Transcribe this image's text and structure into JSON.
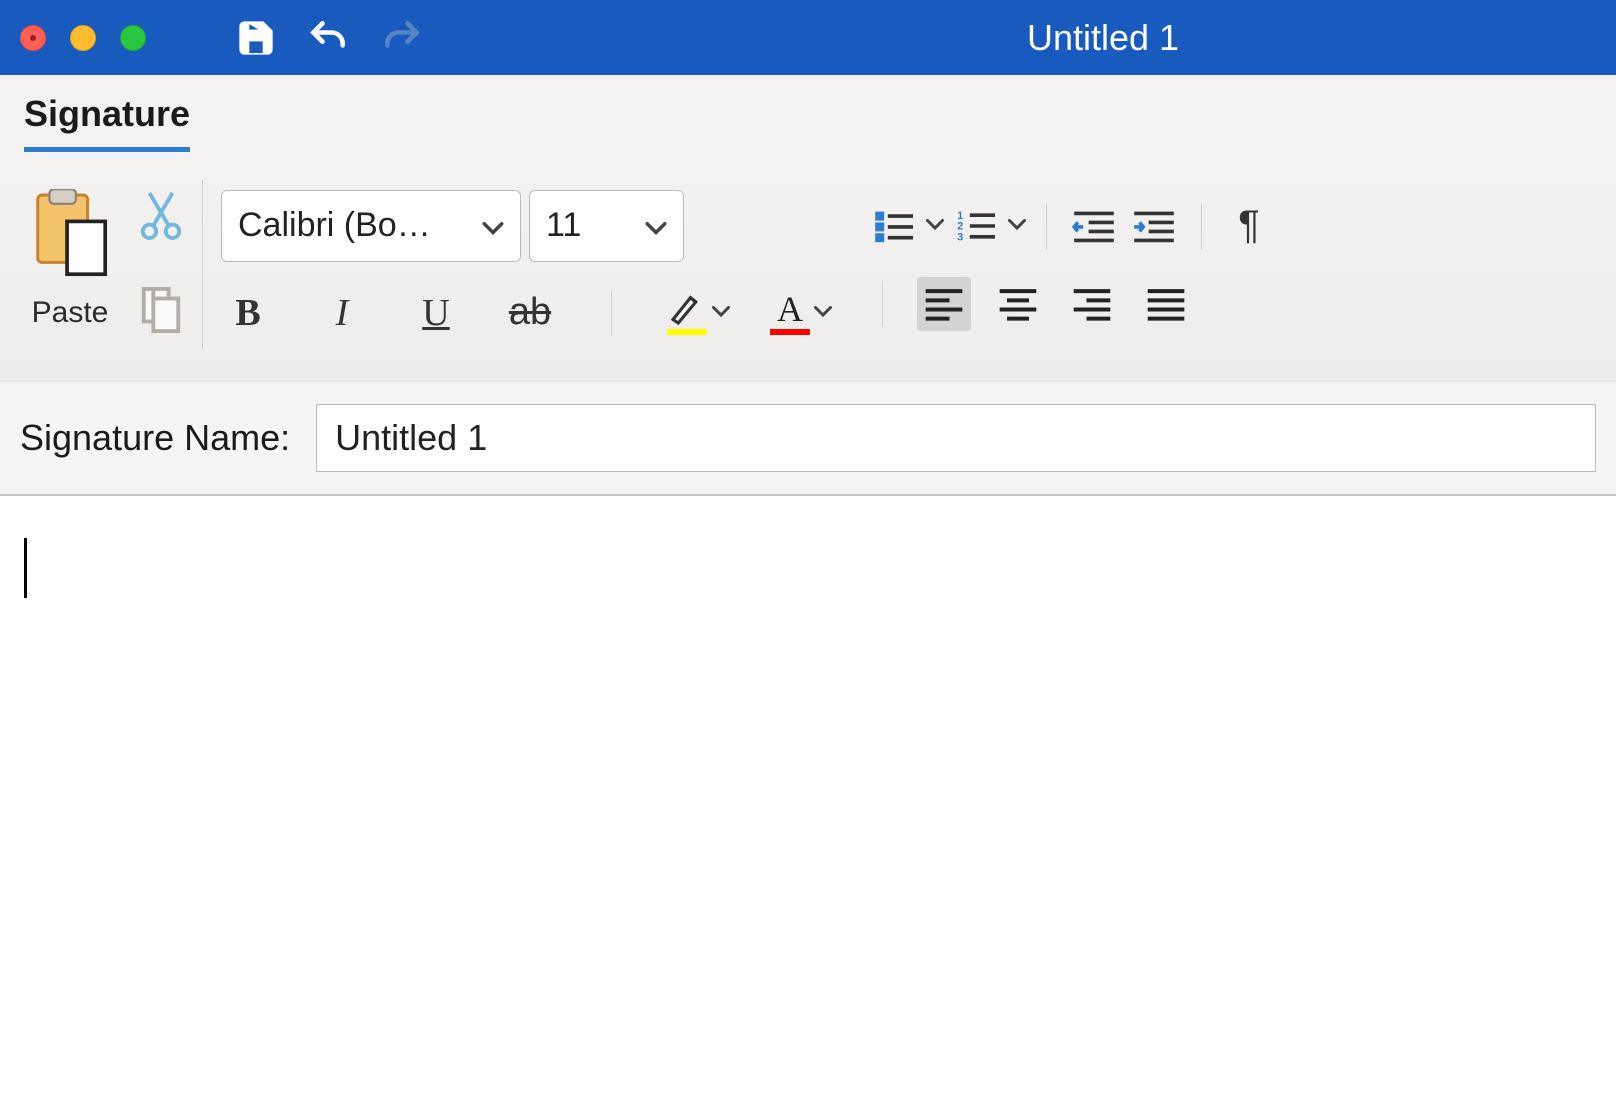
{
  "titlebar": {
    "title": "Untitled 1"
  },
  "ribbon": {
    "tab_label": "Signature",
    "paste_label": "Paste",
    "font_name": "Calibri (Bo…",
    "font_size": "11"
  },
  "signature": {
    "label": "Signature Name:",
    "value": "Untitled 1"
  },
  "colors": {
    "highlight": "#ffff00",
    "fontcolor": "#ff0000"
  }
}
